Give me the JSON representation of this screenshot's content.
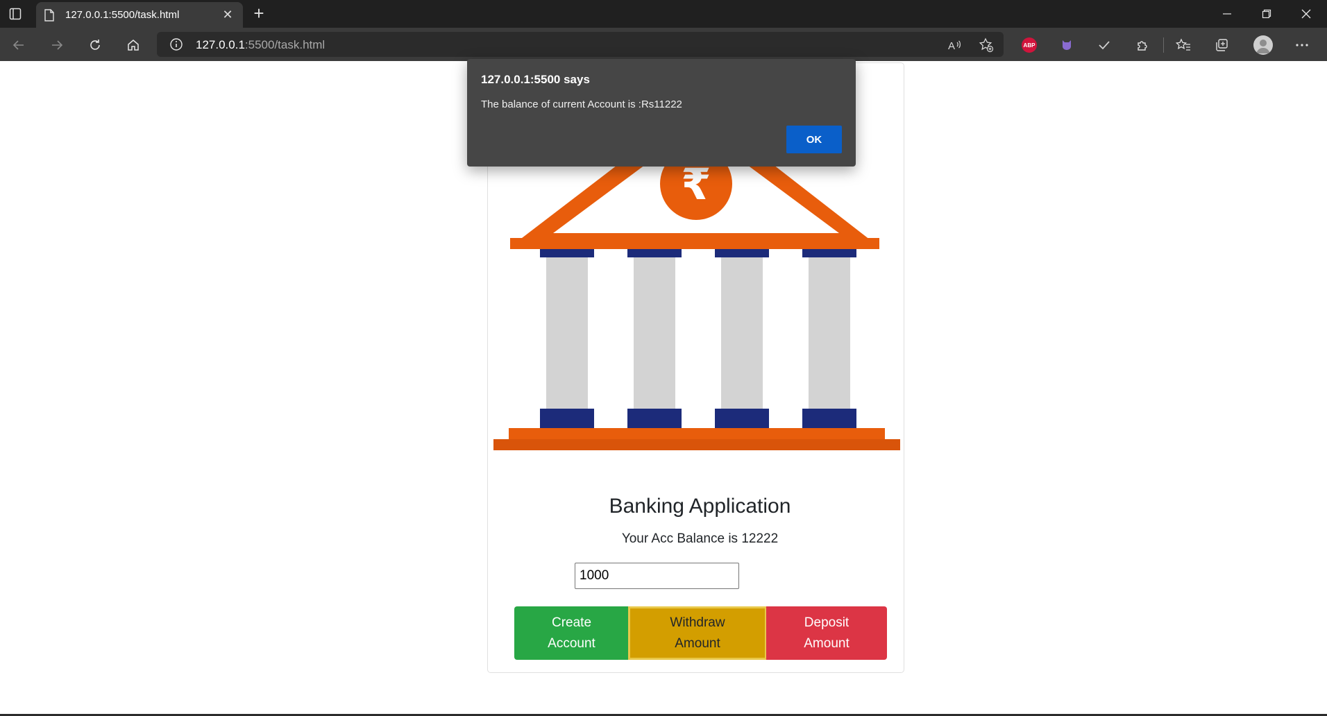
{
  "browser": {
    "tab_title": "127.0.0.1:5500/task.html",
    "url_host": "127.0.0.1",
    "url_path": ":5500/task.html",
    "new_tab_glyph": "+",
    "close_glyph": "✕"
  },
  "page": {
    "heading": "Banking Application",
    "balance_text": "Your Acc Balance is 12222",
    "amount_value": "1000",
    "buttons": {
      "create": [
        "Create",
        "Account"
      ],
      "withdraw": [
        "Withdraw",
        "Amount"
      ],
      "deposit": [
        "Deposit",
        "Amount"
      ]
    }
  },
  "dialog": {
    "title": "127.0.0.1:5500 says",
    "message": "The balance of current Account is :Rs11222",
    "ok_label": "OK"
  },
  "icons": {
    "bank_illustration": "bank-building-rupee",
    "colors": {
      "orange": "#e85d0c",
      "navy": "#1c2b7a",
      "pillar": "#d3d3d3"
    }
  }
}
